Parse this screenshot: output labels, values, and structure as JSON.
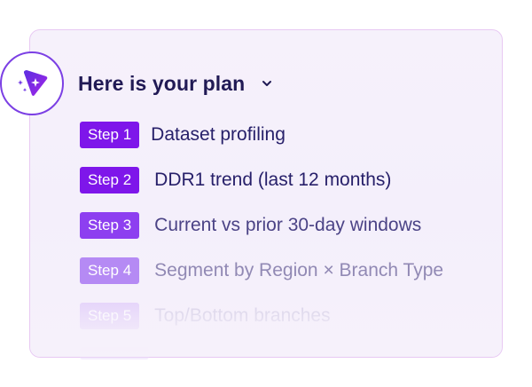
{
  "plan": {
    "title": "Here is your plan",
    "toggle_icon": "chevron-down-icon",
    "logo_icon": "sparkle-play-icon",
    "accent_color": "#7e16ea",
    "steps": [
      {
        "badge": "Step 1",
        "label": "Dataset profiling"
      },
      {
        "badge": "Step 2",
        "label": "DDR1 trend (last 12 months)"
      },
      {
        "badge": "Step 3",
        "label": "Current vs prior 30-day windows"
      },
      {
        "badge": "Step 4",
        "label": "Segment by Region × Branch Type"
      },
      {
        "badge": "Step 5",
        "label": "Top/Bottom branches"
      }
    ]
  }
}
